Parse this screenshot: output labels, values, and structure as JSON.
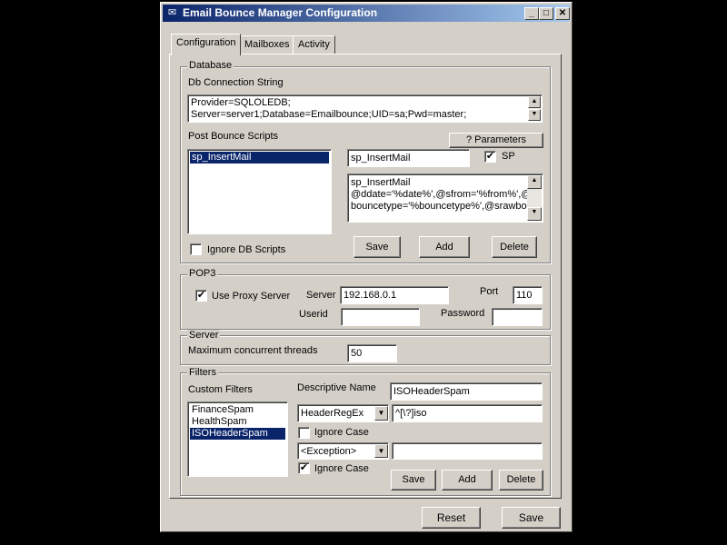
{
  "window": {
    "title": "Email Bounce Manager Configuration",
    "controls": {
      "minimize": "_",
      "maximize": "□",
      "close": "✕"
    }
  },
  "tabs": [
    {
      "label": "Configuration",
      "active": true
    },
    {
      "label": "Mailboxes",
      "active": false
    },
    {
      "label": "Activity",
      "active": false
    }
  ],
  "database": {
    "legend": "Database",
    "conn_label": "Db Connection String",
    "conn_lines": [
      "Provider=SQLOLEDB;",
      "Server=server1;Database=Emailbounce;UID=sa;Pwd=master;"
    ],
    "scripts_label": "Post Bounce Scripts",
    "parameters_button": "? Parameters",
    "scripts": [
      {
        "name": "sp_InsertMail",
        "selected": true
      }
    ],
    "script_name": "sp_InsertMail",
    "sp_label": "SP",
    "sp_checked": true,
    "script_body_lines": [
      "sp_InsertMail",
      "@ddate='%date%',@sfrom='%from%',@s",
      "bouncetype='%bouncetype%',@srawbod"
    ],
    "ignore_label": "Ignore DB Scripts",
    "ignore_checked": false,
    "save_button": "Save",
    "add_button": "Add",
    "delete_button": "Delete"
  },
  "pop3": {
    "legend": "POP3",
    "use_proxy_label": "Use Proxy Server",
    "use_proxy_checked": true,
    "server_label": "Server",
    "server_value": "192.168.0.1",
    "port_label": "Port",
    "port_value": "110",
    "userid_label": "Userid",
    "userid_value": "",
    "password_label": "Password",
    "password_value": ""
  },
  "server": {
    "legend": "Server",
    "threads_label": "Maximum concurrent threads",
    "threads_value": "50"
  },
  "filters": {
    "legend": "Filters",
    "custom_label": "Custom Filters",
    "items": [
      {
        "name": "FinanceSpam",
        "selected": false
      },
      {
        "name": "HealthSpam",
        "selected": false
      },
      {
        "name": "ISOHeaderSpam",
        "selected": true
      }
    ],
    "desc_label": "Descriptive Name",
    "desc_value": "ISOHeaderSpam",
    "type_select": "HeaderRegEx",
    "type_value": "^[\\?]iso",
    "ignore_case_1_label": "Ignore Case",
    "ignore_case_1_checked": false,
    "exception_select": "<Exception>",
    "exception_value": "",
    "ignore_case_2_label": "Ignore Case",
    "ignore_case_2_checked": true,
    "save_button": "Save",
    "add_button": "Add",
    "delete_button": "Delete"
  },
  "footer": {
    "reset_button": "Reset",
    "save_button": "Save"
  },
  "icons": {
    "check": "✔",
    "arrow_up": "▲",
    "arrow_down": "▼",
    "app": "✉"
  }
}
